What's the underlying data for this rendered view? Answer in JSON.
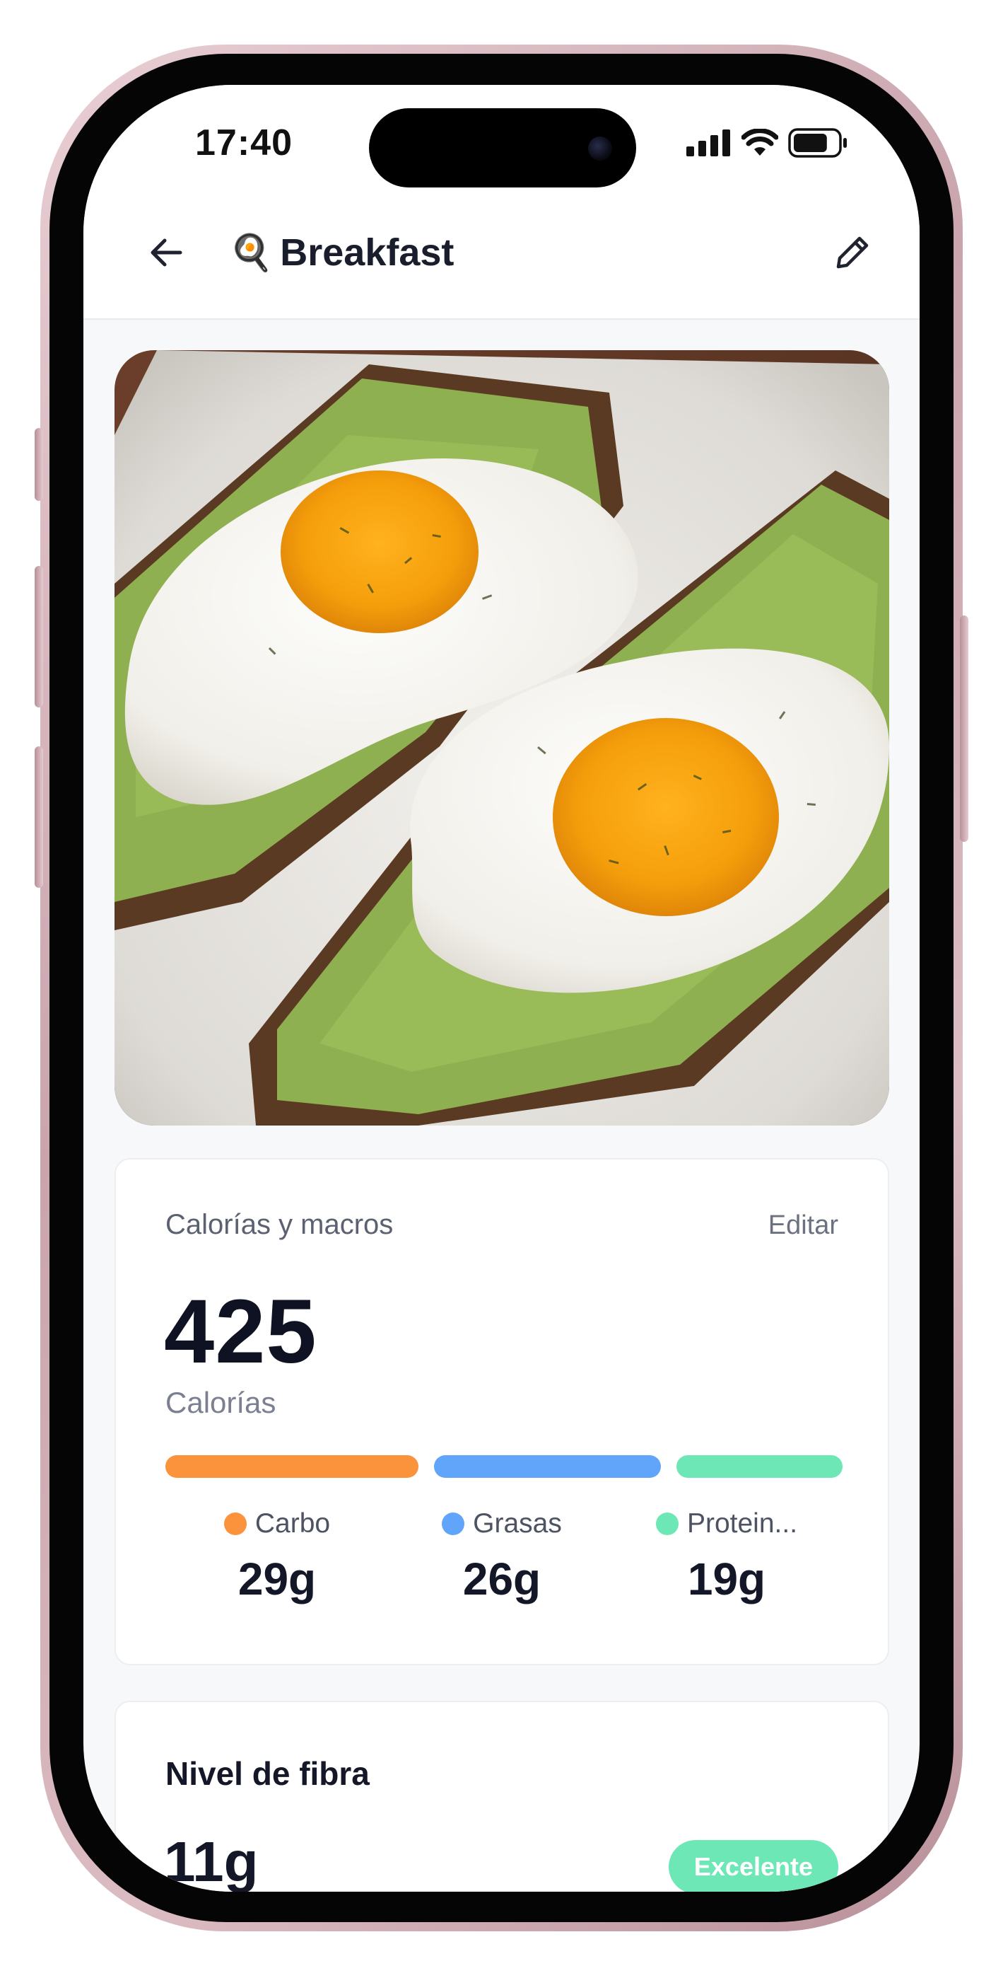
{
  "status_bar": {
    "time": "17:40",
    "battery_level": 0.78
  },
  "header": {
    "emoji": "🍳",
    "title": "Breakfast"
  },
  "food": {
    "image_icon": "avocado-toast-fried-eggs-photo"
  },
  "macros_card": {
    "heading": "Calorías y macros",
    "edit_label": "Editar",
    "calories_value": "425",
    "calories_label": "Calorías",
    "macros": [
      {
        "name": "Carbo",
        "amount": "29g",
        "grams": 29,
        "color": "#fb923c"
      },
      {
        "name": "Grasas",
        "amount": "26g",
        "grams": 26,
        "color": "#60a5fa"
      },
      {
        "name": "Protein...",
        "amount": "19g",
        "grams": 19,
        "color": "#6ee7b7"
      }
    ]
  },
  "fiber_card": {
    "title": "Nivel de fibra",
    "value": "11g",
    "badge": "Excelente",
    "badge_color": "#6ee7b7"
  }
}
